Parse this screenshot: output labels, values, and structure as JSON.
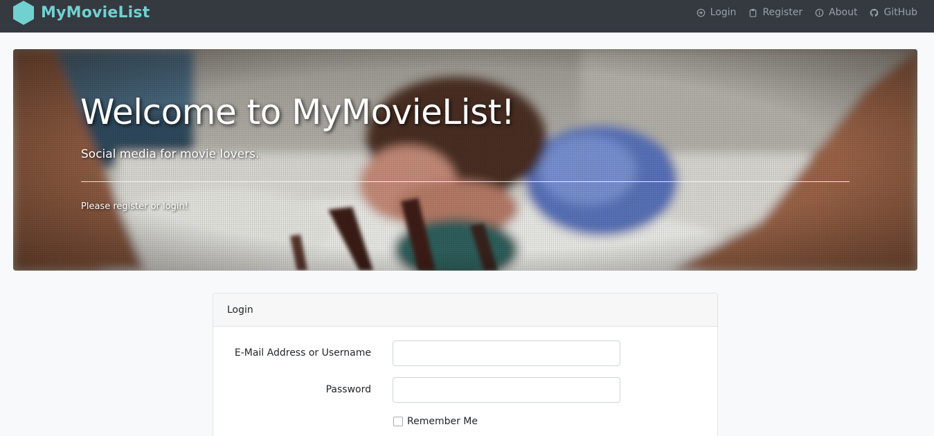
{
  "colors": {
    "navbar_bg": "#343a40",
    "brand": "#71d1d0",
    "nav_link": "#9aa1a8",
    "page_bg": "#f8f9fa"
  },
  "brand": {
    "name": "MyMovieList",
    "logo_icon": "hexagon-logo-icon"
  },
  "nav": {
    "items": [
      {
        "label": "Login",
        "icon": "login-icon"
      },
      {
        "label": "Register",
        "icon": "clipboard-icon"
      },
      {
        "label": "About",
        "icon": "info-icon"
      },
      {
        "label": "GitHub",
        "icon": "github-icon"
      }
    ]
  },
  "hero": {
    "title": "Welcome to MyMovieList!",
    "lead": "Social media for movie lovers.",
    "note": "Please register or login!"
  },
  "login": {
    "header": "Login",
    "email_label": "E-Mail Address or Username",
    "email_value": "",
    "password_label": "Password",
    "password_value": "",
    "remember_label": "Remember Me",
    "remember_checked": false
  }
}
